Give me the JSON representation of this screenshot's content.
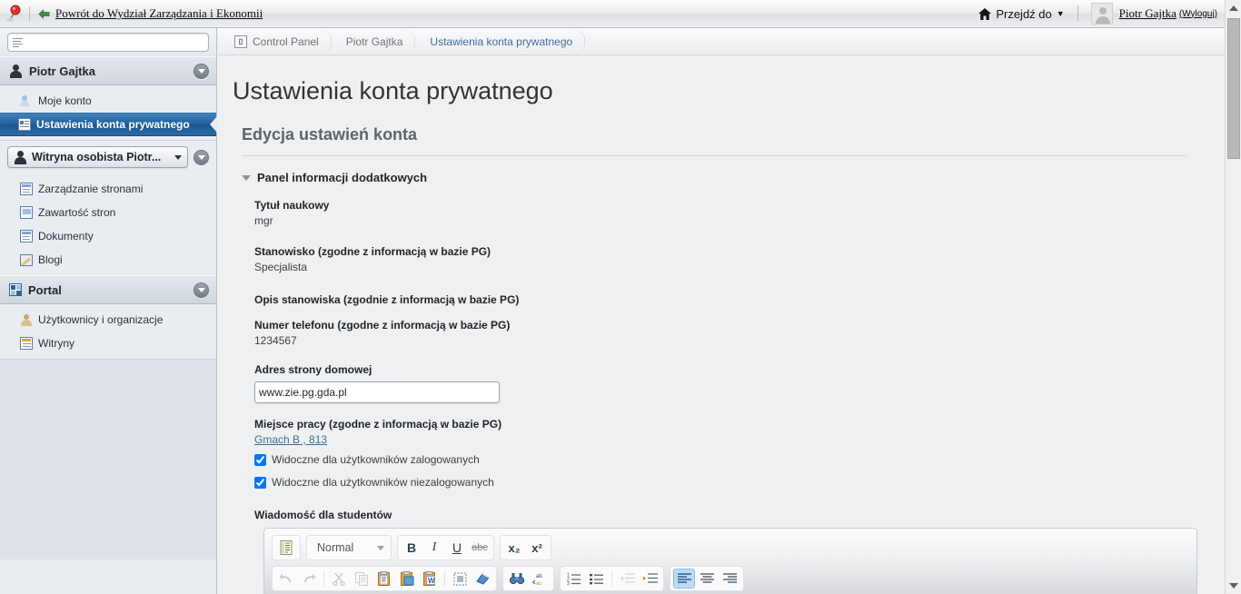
{
  "topbar": {
    "pin_icon": "pin-icon",
    "back_arrow_icon": "back-arrow-icon",
    "back_label": "Powrót do Wydział Zarządzania i Ekonomii",
    "home_icon": "home-icon",
    "goto_label": "Przejdź do",
    "goto_caret": "▼",
    "avatar": "avatar",
    "user_name": "Piotr Gajtka",
    "logout_label": "(Wyloguj)"
  },
  "sidebar": {
    "search": {
      "placeholder": "",
      "value": "",
      "icon": "lines-icon"
    },
    "sections": [
      {
        "title": "Piotr Gajtka",
        "icon": "person-icon",
        "toggle_icon": "chevron-down-icon",
        "items": [
          {
            "label": "Moje konto",
            "icon": "user-gear-icon",
            "selected": false
          },
          {
            "label": "Ustawienia konta prywatnego",
            "icon": "id-card-icon",
            "selected": true
          }
        ]
      },
      {
        "site_selector": {
          "label": "Witryna osobista Piotr...",
          "icon": "person-icon",
          "caret": "▼",
          "toggle_icon": "chevron-down-icon"
        },
        "items": [
          {
            "label": "Zarządzanie stronami",
            "icon": "page-manage-icon",
            "selected": false
          },
          {
            "label": "Zawartość stron",
            "icon": "page-content-icon",
            "selected": false
          },
          {
            "label": "Dokumenty",
            "icon": "documents-icon",
            "selected": false
          },
          {
            "label": "Blogi",
            "icon": "blog-pencil-icon",
            "selected": false
          }
        ]
      },
      {
        "title": "Portal",
        "icon": "portal-icon",
        "toggle_icon": "chevron-down-icon",
        "items": [
          {
            "label": "Użytkownicy i organizacje",
            "icon": "users-icon",
            "selected": false
          },
          {
            "label": "Witryny",
            "icon": "sites-icon",
            "selected": false
          }
        ]
      }
    ]
  },
  "breadcrumb": {
    "home_icon": "control-panel-icon",
    "items": [
      {
        "label": "Control Panel",
        "active": false
      },
      {
        "label": "Piotr Gajtka",
        "active": false
      },
      {
        "label": "Ustawienia konta prywatnego",
        "active": true
      }
    ]
  },
  "main": {
    "page_title": "Ustawienia konta prywatnego",
    "section_title": "Edycja ustawień konta",
    "panel": {
      "toggle_icon": "triangle-down-icon",
      "label": "Panel informacji dodatkowych"
    },
    "fields": {
      "title_label": "Tytuł naukowy",
      "title_value": "mgr",
      "position_label": "Stanowisko (zgodne z informacją w bazie PG)",
      "position_value": "Specjalista",
      "position_desc_label": "Opis stanowiska (zgodnie z informacją w bazie PG)",
      "position_desc_value": "",
      "phone_label": "Numer telefonu (zgodne z informacją w bazie PG)",
      "phone_value": "1234567",
      "homepage_label": "Adres strony domowej",
      "homepage_value": "www.zie.pg.gda.pl",
      "homepage_placeholder": "",
      "workplace_label": "Miejsce pracy (zgodne z informacją w bazie PG)",
      "workplace_link": "Gmach B , 813",
      "checkbox_logged_in": "Widoczne dla użytkowników zalogowanych",
      "checkbox_logged_in_checked": true,
      "checkbox_logged_out": "Widoczne dla użytkowników niezalogowanych",
      "checkbox_logged_out_checked": true,
      "message_label": "Wiadomość dla studentów"
    },
    "editor": {
      "row1": {
        "source_icon": "source-document-icon",
        "format_value": "Normal",
        "format_caret": "▼",
        "bold": "B",
        "italic": "I",
        "underline": "U",
        "strike": "abc",
        "subscript": "x₂",
        "superscript": "x²"
      },
      "row2": {
        "undo_icon": "undo-icon",
        "redo_icon": "redo-icon",
        "cut_icon": "scissors-icon",
        "copy_icon": "copy-icon",
        "paste_icon": "paste-icon",
        "paste_text_icon": "paste-plain-text-icon",
        "paste_word_icon": "paste-from-word-icon",
        "select_all_icon": "select-all-icon",
        "remove_format_icon": "remove-format-eraser-icon",
        "find_icon": "find-binoculars-icon",
        "replace_icon": "replace-abc-icon",
        "numbered_list_icon": "numbered-list-icon",
        "bullet_list_icon": "bulleted-list-icon",
        "outdent_icon": "decrease-indent-icon",
        "indent_icon": "increase-indent-icon",
        "align_left_icon": "align-left-icon",
        "align_center_icon": "align-center-icon",
        "align_right_icon": "align-right-icon"
      }
    }
  },
  "scrollbar": {
    "up_icon": "scroll-up-icon",
    "down_icon": "scroll-down-icon",
    "thumb": "scroll-thumb"
  },
  "colors": {
    "accent_blue": "#1f5f9b",
    "link_blue": "#3f6c93",
    "page_bg": "#eff0f2",
    "sidebar_bg": "#e9edf1",
    "toolbar_active": "#bcdcf5"
  }
}
